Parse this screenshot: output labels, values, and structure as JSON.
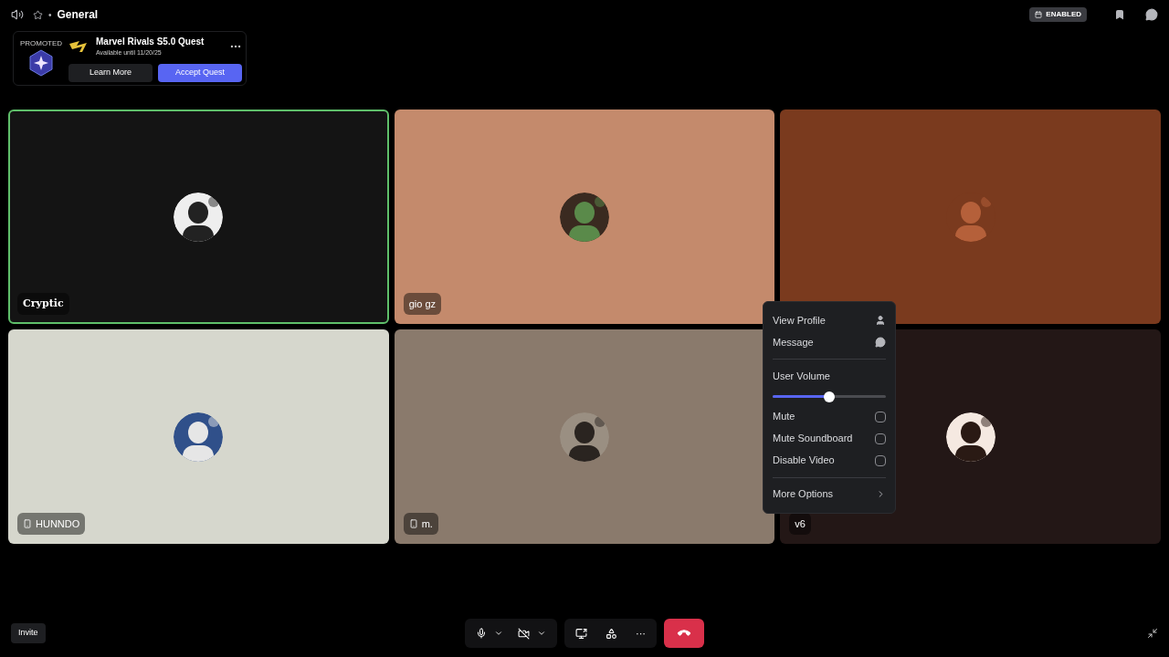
{
  "header": {
    "separator": "•",
    "title": "General",
    "badge": "ENABLED"
  },
  "quest": {
    "tag": "PROMOTED",
    "title": "Marvel Rivals S5.0 Quest",
    "subtitle": "Available until 11/20/25",
    "buttons": [
      {
        "label": "Learn More",
        "kind": "secondary"
      },
      {
        "label": "Accept Quest",
        "kind": "primary"
      }
    ]
  },
  "tiles": [
    {
      "name": "Cryptic",
      "color": "#141414",
      "speaking": true,
      "mobile": false
    },
    {
      "name": "gio gz",
      "color": "#c48a6c",
      "speaking": false,
      "mobile": false
    },
    {
      "color": "#7a3a1e",
      "speaking": false
    },
    {
      "name": "HUNNDO",
      "color": "#d6d7cd",
      "speaking": false,
      "mobile": true
    },
    {
      "name": "m.",
      "color": "#8a7a6c",
      "speaking": false,
      "mobile": true
    },
    {
      "name": "v6",
      "color": "#231716",
      "speaking": false,
      "mobile": false
    }
  ],
  "context_menu": {
    "items": [
      {
        "kind": "profile",
        "label": "View Profile"
      },
      {
        "kind": "message",
        "label": "Message"
      },
      {
        "kind": "divider"
      },
      {
        "kind": "slider",
        "label": "User Volume",
        "level": 0.5
      },
      {
        "kind": "checkbox",
        "label": "Mute",
        "checked": false
      },
      {
        "kind": "checkbox",
        "label": "Mute Soundboard",
        "checked": false
      },
      {
        "kind": "checkbox",
        "label": "Disable Video",
        "checked": false
      },
      {
        "kind": "divider"
      },
      {
        "kind": "submenu",
        "label": "More Options"
      }
    ]
  },
  "footer": {
    "invite": "Invite",
    "ellipsis": "···"
  }
}
